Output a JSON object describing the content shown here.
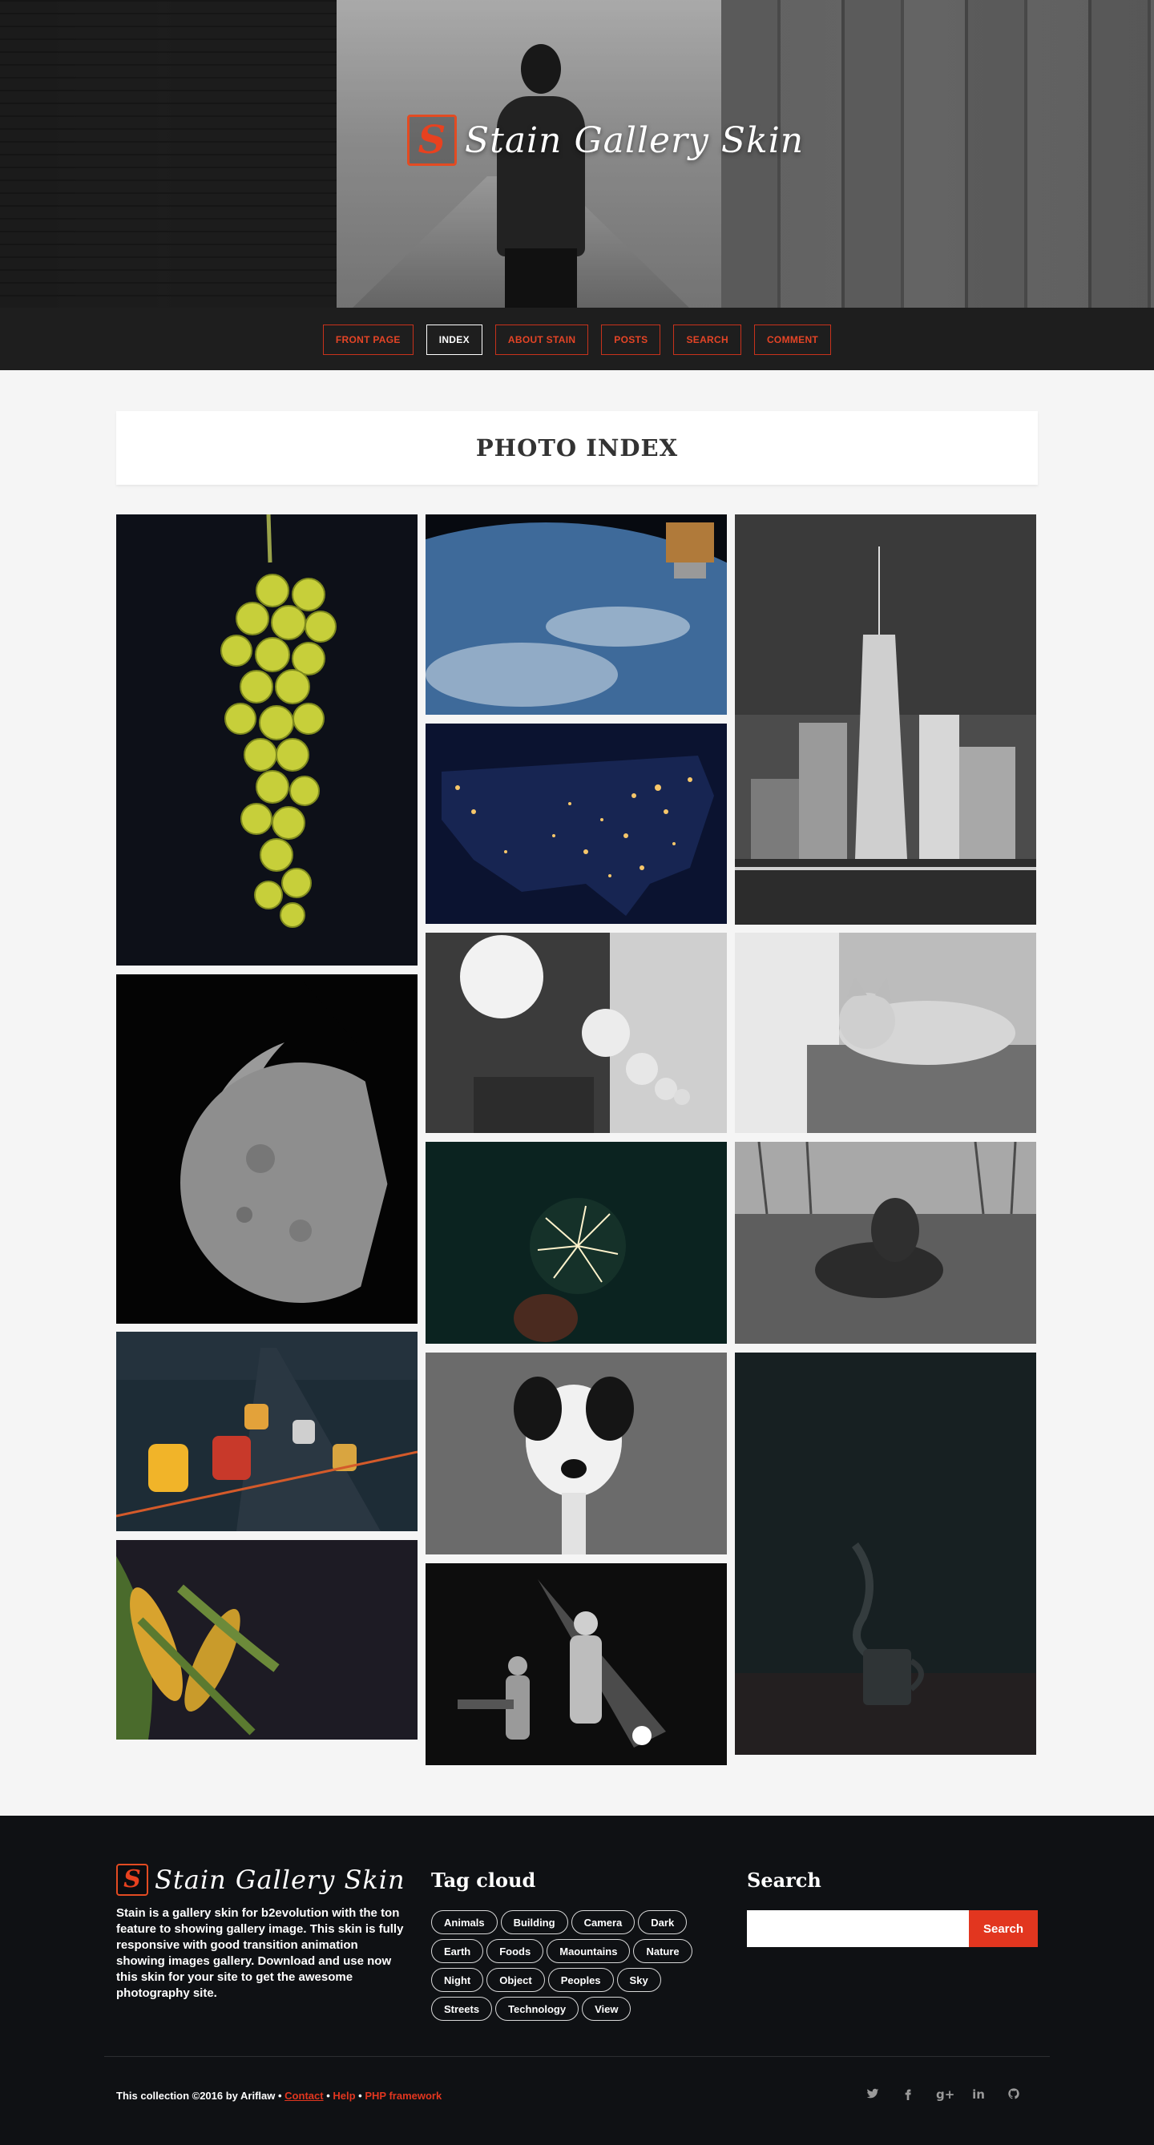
{
  "site": {
    "title": "Stain Gallery Skin",
    "logo_letter": "S"
  },
  "nav": {
    "items": [
      {
        "label": "FRONT PAGE",
        "active": false
      },
      {
        "label": "INDEX",
        "active": true
      },
      {
        "label": "ABOUT STAIN",
        "active": false
      },
      {
        "label": "POSTS",
        "active": false
      },
      {
        "label": "SEARCH",
        "active": false
      },
      {
        "label": "COMMENT",
        "active": false
      }
    ]
  },
  "page": {
    "title": "PHOTO INDEX"
  },
  "gallery": {
    "photos": [
      "grapes",
      "moon",
      "city-traffic",
      "corn",
      "earth-from-space",
      "usa-night-lights",
      "hanging-lamps",
      "sparkler",
      "dog-portrait",
      "concert",
      "skyscrapers",
      "cat",
      "spaniel-on-grass",
      "coffee-mug"
    ]
  },
  "footer": {
    "about": "Stain is a gallery skin for b2evolution with the ton feature to showing gallery image. This skin is fully responsive with good transition animation showing images gallery. Download and use now this skin for your site to get the awesome photography site.",
    "tag_cloud_title": "Tag cloud",
    "tags": [
      "Animals",
      "Building",
      "Camera",
      "Dark",
      "Earth",
      "Foods",
      "Maountains",
      "Nature",
      "Night",
      "Object",
      "Peoples",
      "Sky",
      "Streets",
      "Technology",
      "View"
    ],
    "search_title": "Search",
    "search_placeholder": "",
    "search_button": "Search",
    "copyright_prefix": "This collection ©2016 by Ariflaw •",
    "link_contact": "Contact",
    "link_help": "Help",
    "link_php": "PHP framework",
    "sep": "•",
    "socials": [
      "twitter-icon",
      "facebook-icon",
      "google-plus-icon",
      "linkedin-icon",
      "github-icon"
    ]
  },
  "colors": {
    "accent": "#e2361f",
    "nav_bg": "#1e1e1e",
    "footer_bg": "#0f1114",
    "page_bg": "#f5f5f5"
  }
}
